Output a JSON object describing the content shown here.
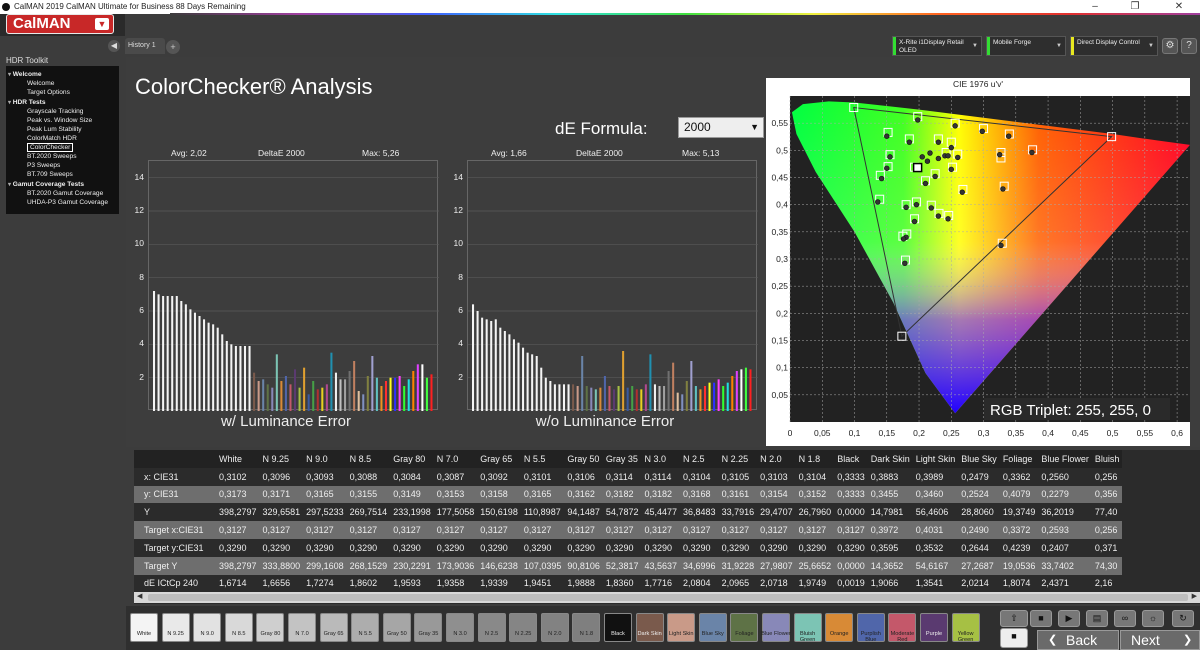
{
  "window": {
    "title": "CalMAN 2019 CalMAN Ultimate for Business 88 Days Remaining",
    "minimize": "–",
    "maximize": "❐",
    "close": "✕"
  },
  "logo": "CalMAN",
  "sidebar": {
    "header": "HDR Toolkit",
    "sections": [
      {
        "label": "Welcome",
        "items": [
          "Welcome",
          "Target Options"
        ]
      },
      {
        "label": "HDR Tests",
        "items": [
          "Grayscale Tracking",
          "Peak vs. Window Size",
          "Peak Lum Stability",
          "ColorMatch HDR",
          "ColorChecker",
          "BT.2020 Sweeps",
          "P3 Sweeps",
          "BT.709 Sweeps"
        ]
      },
      {
        "label": "Gamut Coverage Tests",
        "items": [
          "BT.2020 Gamut Coverage",
          "UHDA-P3 Gamut Coverage"
        ]
      }
    ],
    "selected": "ColorChecker"
  },
  "tabs": {
    "history": "History 1",
    "add": "+"
  },
  "devices": [
    {
      "label": "X-Rite i1Display Retail\nOLED",
      "color": "#33dd33"
    },
    {
      "label": "Mobile Forge",
      "color": "#33dd33"
    },
    {
      "label": "Direct Display Control",
      "color": "#e8e820"
    }
  ],
  "main": {
    "title": "ColorChecker® Analysis",
    "de_formula_label": "dE Formula:",
    "de_formula_value": "2000",
    "chart1": {
      "avg": "Avg: 2,02",
      "metric": "DeltaE 2000",
      "max": "Max: 5,26",
      "label": "w/ Luminance Error"
    },
    "chart2": {
      "avg": "Avg: 1,66",
      "metric": "DeltaE 2000",
      "max": "Max: 5,13",
      "label": "w/o Luminance Error"
    },
    "cie_title": "CIE 1976 u'v'",
    "rgb_triplet": "RGB Triplet: 255, 255, 0"
  },
  "chart_data": [
    {
      "type": "bar",
      "title": "DeltaE 2000",
      "xlabel": "w/ Luminance Error",
      "ylim": [
        0,
        15
      ],
      "yticks": [
        2,
        4,
        6,
        8,
        10,
        12,
        14
      ],
      "values": [
        7.2,
        7.0,
        6.9,
        6.9,
        6.9,
        6.9,
        6.6,
        6.4,
        6.1,
        5.9,
        5.7,
        5.5,
        5.3,
        5.2,
        5.0,
        4.6,
        4.2,
        4.0,
        3.9,
        3.9,
        3.9,
        3.9,
        2.3,
        1.8,
        1.9,
        1.6,
        1.4,
        3.4,
        1.8,
        2.1,
        1.6,
        2.5,
        1.4,
        2.6,
        1.0,
        1.8,
        1.3,
        1.4,
        1.6,
        3.5,
        2.3,
        1.9,
        1.9,
        2.4,
        3.0,
        1.2,
        1.0,
        2.1,
        3.3,
        2.0,
        1.5,
        1.8,
        2.0,
        2.0,
        2.1,
        1.5,
        1.9,
        2.4,
        2.8,
        2.8,
        2.0,
        2.2
      ]
    },
    {
      "type": "bar",
      "title": "DeltaE 2000",
      "xlabel": "w/o Luminance Error",
      "ylim": [
        0,
        15
      ],
      "yticks": [
        2,
        4,
        6,
        8,
        10,
        12,
        14
      ],
      "values": [
        6.4,
        6.0,
        5.6,
        5.5,
        5.4,
        5.5,
        5.0,
        4.8,
        4.6,
        4.3,
        4.1,
        3.8,
        3.5,
        3.4,
        3.3,
        2.6,
        2.0,
        1.8,
        1.6,
        1.6,
        1.6,
        1.6,
        1.6,
        1.5,
        3.3,
        1.5,
        1.4,
        1.3,
        1.4,
        2.1,
        1.5,
        1.3,
        1.5,
        3.6,
        1.4,
        1.5,
        1.3,
        1.3,
        1.6,
        3.4,
        1.6,
        1.5,
        1.5,
        2.4,
        2.9,
        1.1,
        1.0,
        1.8,
        3.0,
        1.5,
        1.3,
        1.5,
        1.7,
        1.7,
        1.9,
        1.5,
        1.7,
        2.1,
        2.4,
        2.5,
        2.6,
        2.5
      ]
    },
    {
      "type": "scatter",
      "title": "CIE 1976 u'v'",
      "xlim": [
        0,
        0.62
      ],
      "ylim": [
        0,
        0.6
      ],
      "xticks": [
        "0",
        "0,05",
        "0,1",
        "0,15",
        "0,2",
        "0,25",
        "0,3",
        "0,35",
        "0,4",
        "0,45",
        "0,5",
        "0,55",
        "0,6"
      ],
      "yticks": [
        "0,05",
        "0,1",
        "0,15",
        "0,2",
        "0,25",
        "0,3",
        "0,35",
        "0,4",
        "0,45",
        "0,5",
        "0,55"
      ],
      "gamut": {
        "red": [
          0.4985,
          0.5252
        ],
        "green": [
          0.0988,
          0.5788
        ],
        "blue": [
          0.1734,
          0.1579
        ],
        "white": [
          0.1978,
          0.4683
        ]
      },
      "targets": [
        [
          0.0988,
          0.5788
        ],
        [
          0.198,
          0.562
        ],
        [
          0.256,
          0.55
        ],
        [
          0.3,
          0.54
        ],
        [
          0.34,
          0.53
        ],
        [
          0.152,
          0.533
        ],
        [
          0.185,
          0.521
        ],
        [
          0.23,
          0.521
        ],
        [
          0.25,
          0.515
        ],
        [
          0.155,
          0.492
        ],
        [
          0.242,
          0.496
        ],
        [
          0.26,
          0.493
        ],
        [
          0.327,
          0.496
        ],
        [
          0.327,
          0.486
        ],
        [
          0.376,
          0.501
        ],
        [
          0.4985,
          0.5252
        ],
        [
          0.193,
          0.469
        ],
        [
          0.252,
          0.469
        ],
        [
          0.225,
          0.457
        ],
        [
          0.152,
          0.47
        ],
        [
          0.14,
          0.454
        ],
        [
          0.21,
          0.444
        ],
        [
          0.332,
          0.434
        ],
        [
          0.268,
          0.428
        ],
        [
          0.139,
          0.41
        ],
        [
          0.18,
          0.4
        ],
        [
          0.196,
          0.405
        ],
        [
          0.219,
          0.399
        ],
        [
          0.193,
          0.374
        ],
        [
          0.231,
          0.384
        ],
        [
          0.246,
          0.38
        ],
        [
          0.181,
          0.346
        ],
        [
          0.175,
          0.342
        ],
        [
          0.329,
          0.329
        ],
        [
          0.179,
          0.298
        ],
        [
          0.1734,
          0.1579
        ]
      ],
      "measured": [
        [
          0.198,
          0.556
        ],
        [
          0.256,
          0.545
        ],
        [
          0.298,
          0.535
        ],
        [
          0.339,
          0.526
        ],
        [
          0.15,
          0.526
        ],
        [
          0.185,
          0.515
        ],
        [
          0.23,
          0.515
        ],
        [
          0.25,
          0.505
        ],
        [
          0.155,
          0.488
        ],
        [
          0.24,
          0.49
        ],
        [
          0.26,
          0.487
        ],
        [
          0.325,
          0.492
        ],
        [
          0.375,
          0.496
        ],
        [
          0.213,
          0.48
        ],
        [
          0.205,
          0.488
        ],
        [
          0.217,
          0.495
        ],
        [
          0.23,
          0.485
        ],
        [
          0.245,
          0.49
        ],
        [
          0.195,
          0.465
        ],
        [
          0.25,
          0.465
        ],
        [
          0.225,
          0.452
        ],
        [
          0.15,
          0.467
        ],
        [
          0.142,
          0.448
        ],
        [
          0.21,
          0.439
        ],
        [
          0.33,
          0.429
        ],
        [
          0.267,
          0.423
        ],
        [
          0.136,
          0.405
        ],
        [
          0.18,
          0.395
        ],
        [
          0.196,
          0.4
        ],
        [
          0.219,
          0.394
        ],
        [
          0.193,
          0.369
        ],
        [
          0.23,
          0.379
        ],
        [
          0.245,
          0.374
        ],
        [
          0.18,
          0.34
        ],
        [
          0.176,
          0.337
        ],
        [
          0.327,
          0.325
        ],
        [
          0.178,
          0.292
        ]
      ]
    }
  ],
  "table": {
    "columns": [
      "",
      "White",
      "N 9.25",
      "N 9.0",
      "N 8.5",
      "Gray 80",
      "N 7.0",
      "Gray 65",
      "N 5.5",
      "Gray 50",
      "Gray 35",
      "N 3.0",
      "N 2.5",
      "N 2.25",
      "N 2.0",
      "N 1.8",
      "Black",
      "Dark Skin",
      "Light Skin",
      "Blue Sky",
      "Foliage",
      "Blue Flower",
      "Bluish"
    ],
    "rows": [
      {
        "label": "x: CIE31",
        "values": [
          "0,3102",
          "0,3096",
          "0,3093",
          "0,3088",
          "0,3084",
          "0,3087",
          "0,3092",
          "0,3101",
          "0,3106",
          "0,3114",
          "0,3114",
          "0,3104",
          "0,3105",
          "0,3103",
          "0,3104",
          "0,3333",
          "0,3883",
          "0,3989",
          "0,2479",
          "0,3362",
          "0,2560",
          "0,256"
        ]
      },
      {
        "label": "y: CIE31",
        "values": [
          "0,3173",
          "0,3171",
          "0,3165",
          "0,3155",
          "0,3149",
          "0,3153",
          "0,3158",
          "0,3165",
          "0,3162",
          "0,3182",
          "0,3182",
          "0,3168",
          "0,3161",
          "0,3154",
          "0,3152",
          "0,3333",
          "0,3455",
          "0,3460",
          "0,2524",
          "0,4079",
          "0,2279",
          "0,356"
        ]
      },
      {
        "label": "Y",
        "values": [
          "398,2797",
          "329,6581",
          "297,5233",
          "269,7514",
          "233,1998",
          "177,5058",
          "150,6198",
          "110,8987",
          "94,1487",
          "54,7872",
          "45,4477",
          "36,8483",
          "33,7916",
          "29,4707",
          "26,7960",
          "0,0000",
          "14,7981",
          "56,4606",
          "28,8060",
          "19,3749",
          "36,2019",
          "77,40"
        ]
      },
      {
        "label": "Target x:CIE31",
        "values": [
          "0,3127",
          "0,3127",
          "0,3127",
          "0,3127",
          "0,3127",
          "0,3127",
          "0,3127",
          "0,3127",
          "0,3127",
          "0,3127",
          "0,3127",
          "0,3127",
          "0,3127",
          "0,3127",
          "0,3127",
          "0,3127",
          "0,3972",
          "0,4031",
          "0,2490",
          "0,3372",
          "0,2593",
          "0,256"
        ]
      },
      {
        "label": "Target y:CIE31",
        "values": [
          "0,3290",
          "0,3290",
          "0,3290",
          "0,3290",
          "0,3290",
          "0,3290",
          "0,3290",
          "0,3290",
          "0,3290",
          "0,3290",
          "0,3290",
          "0,3290",
          "0,3290",
          "0,3290",
          "0,3290",
          "0,3290",
          "0,3595",
          "0,3532",
          "0,2644",
          "0,4239",
          "0,2407",
          "0,371"
        ]
      },
      {
        "label": "Target Y",
        "values": [
          "398,2797",
          "333,8800",
          "299,1608",
          "268,1529",
          "230,2291",
          "173,9036",
          "146,6238",
          "107,0395",
          "90,8106",
          "52,3817",
          "43,5637",
          "34,6996",
          "31,9228",
          "27,9807",
          "25,6652",
          "0,0000",
          "14,3652",
          "54,6167",
          "27,2687",
          "19,0536",
          "33,7402",
          "74,30"
        ]
      },
      {
        "label": "dE ICtCp 240",
        "values": [
          "1,6714",
          "1,6656",
          "1,7274",
          "1,8602",
          "1,9593",
          "1,9358",
          "1,9339",
          "1,9451",
          "1,9888",
          "1,8360",
          "1,7716",
          "2,0804",
          "2,0965",
          "2,0718",
          "1,9749",
          "0,0019",
          "1,9066",
          "1,3541",
          "2,0214",
          "1,8074",
          "2,4371",
          "2,16"
        ]
      }
    ]
  },
  "swatches": [
    {
      "label": "White",
      "color": "#f4f4f4"
    },
    {
      "label": "N 9.25",
      "color": "#e9e9e9"
    },
    {
      "label": "N 9.0",
      "color": "#e2e2e2"
    },
    {
      "label": "N 8.5",
      "color": "#d9d9d9"
    },
    {
      "label": "Gray 80",
      "color": "#cfcfcf"
    },
    {
      "label": "N 7.0",
      "color": "#c3c3c3"
    },
    {
      "label": "Gray 65",
      "color": "#bababa"
    },
    {
      "label": "N 5.5",
      "color": "#adadad"
    },
    {
      "label": "Gray 50",
      "color": "#a6a6a6"
    },
    {
      "label": "Gray 35",
      "color": "#999999"
    },
    {
      "label": "N 3.0",
      "color": "#8f8f8f"
    },
    {
      "label": "N 2.5",
      "color": "#898989"
    },
    {
      "label": "N 2.25",
      "color": "#858585"
    },
    {
      "label": "N 2.0",
      "color": "#828282"
    },
    {
      "label": "N 1.8",
      "color": "#7f7f7f"
    },
    {
      "label": "Black",
      "color": "#111111"
    },
    {
      "label": "Dark Skin",
      "color": "#7a5a4c"
    },
    {
      "label": "Light Skin",
      "color": "#c99a88"
    },
    {
      "label": "Blue Sky",
      "color": "#6a84a8"
    },
    {
      "label": "Foliage",
      "color": "#5e7246"
    },
    {
      "label": "Blue Flower",
      "color": "#8888b8"
    },
    {
      "label": "Bluish Green",
      "color": "#7cc4b4"
    },
    {
      "label": "Orange",
      "color": "#d88a36"
    },
    {
      "label": "Purplish Blue",
      "color": "#5066aa"
    },
    {
      "label": "Moderate Red",
      "color": "#c4586a"
    },
    {
      "label": "Purple",
      "color": "#5a3a70"
    },
    {
      "label": "Yellow Green",
      "color": "#a6c044"
    }
  ],
  "nav": {
    "back": "Back",
    "next": "Next"
  }
}
